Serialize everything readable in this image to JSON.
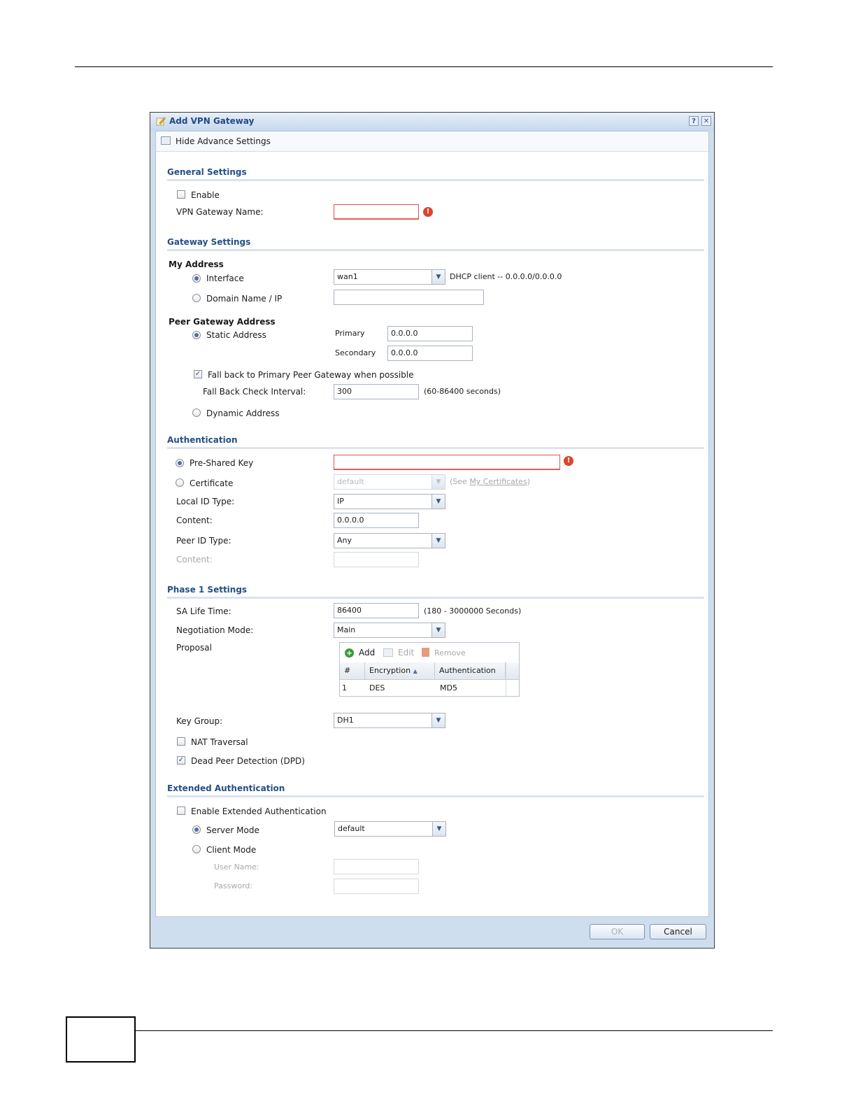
{
  "dialog": {
    "title": "Add VPN Gateway",
    "help_label": "?",
    "close_label": "✕",
    "toolbar": {
      "hide_advance": "Hide Advance Settings"
    }
  },
  "general": {
    "title": "General Settings",
    "enable_label": "Enable",
    "enable_checked": false,
    "name_label": "VPN Gateway Name:",
    "name_value": ""
  },
  "gateway": {
    "title": "Gateway Settings",
    "my_address_label": "My Address",
    "interface_label": "Interface",
    "interface_value": "wan1",
    "interface_info": "DHCP client -- 0.0.0.0/0.0.0.0",
    "domain_label": "Domain Name / IP",
    "domain_value": "",
    "peer_label": "Peer Gateway Address",
    "static_label": "Static Address",
    "primary_label": "Primary",
    "primary_value": "0.0.0.0",
    "secondary_label": "Secondary",
    "secondary_value": "0.0.0.0",
    "fallback_label": "Fall back to Primary Peer Gateway when possible",
    "fallback_checked": true,
    "interval_label": "Fall Back Check Interval:",
    "interval_value": "300",
    "interval_hint": "(60-86400 seconds)",
    "dynamic_label": "Dynamic Address"
  },
  "auth": {
    "title": "Authentication",
    "psk_label": "Pre-Shared Key",
    "psk_value": "",
    "cert_label": "Certificate",
    "cert_value": "default",
    "cert_hint_prefix": "(See ",
    "cert_hint_link": "My Certificates",
    "cert_hint_suffix": ")",
    "local_id_label": "Local ID Type:",
    "local_id_value": "IP",
    "content_label": "Content:",
    "content_value": "0.0.0.0",
    "peer_id_label": "Peer ID Type:",
    "peer_id_value": "Any",
    "peer_content_label": "Content:",
    "peer_content_value": ""
  },
  "phase1": {
    "title": "Phase 1 Settings",
    "sa_label": "SA Life Time:",
    "sa_value": "86400",
    "sa_hint": "(180 - 3000000 Seconds)",
    "mode_label": "Negotiation Mode:",
    "mode_value": "Main",
    "proposal_label": "Proposal",
    "grid": {
      "add": "Add",
      "edit": "Edit",
      "remove": "Remove",
      "headers": [
        "#",
        "Encryption",
        "Authentication"
      ],
      "rows": [
        {
          "num": "1",
          "enc": "DES",
          "auth": "MD5"
        }
      ]
    },
    "keygroup_label": "Key Group:",
    "keygroup_value": "DH1",
    "nat_label": "NAT Traversal",
    "nat_checked": false,
    "dpd_label": "Dead Peer Detection (DPD)",
    "dpd_checked": true
  },
  "xauth": {
    "title": "Extended Authentication",
    "enable_label": "Enable Extended Authentication",
    "enable_checked": false,
    "server_label": "Server Mode",
    "server_value": "default",
    "client_label": "Client Mode",
    "user_label": "User Name:",
    "user_value": "",
    "password_label": "Password:",
    "password_value": ""
  },
  "footer": {
    "ok": "OK",
    "cancel": "Cancel"
  },
  "colors": {
    "section_title": "#244f86",
    "error": "#e0442d",
    "accent": "#1f4a86"
  }
}
